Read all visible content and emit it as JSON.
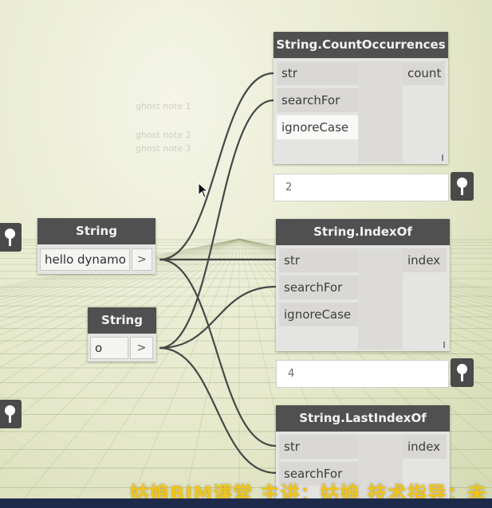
{
  "canvas": {
    "ghost_text": [
      "ghost note 1",
      "ghost note 2",
      "ghost note 3"
    ]
  },
  "nodes": {
    "count_occurrences": {
      "title": "String.CountOccurrences",
      "inputs": [
        "str",
        "searchFor",
        "ignoreCase"
      ],
      "output": "count",
      "preview": "2"
    },
    "index_of": {
      "title": "String.IndexOf",
      "inputs": [
        "str",
        "searchFor",
        "ignoreCase"
      ],
      "output": "index",
      "preview": "4"
    },
    "last_index_of": {
      "title": "String.LastIndexOf",
      "inputs": [
        "str",
        "searchFor"
      ],
      "output": "index"
    },
    "string_hello": {
      "title": "String",
      "value": "hello dynamo",
      "arrow": ">"
    },
    "string_o": {
      "title": "String",
      "value": "o",
      "arrow": ">"
    }
  },
  "watermark": "姑娘BIM课堂 主讲：姑娘 技术指导：未"
}
